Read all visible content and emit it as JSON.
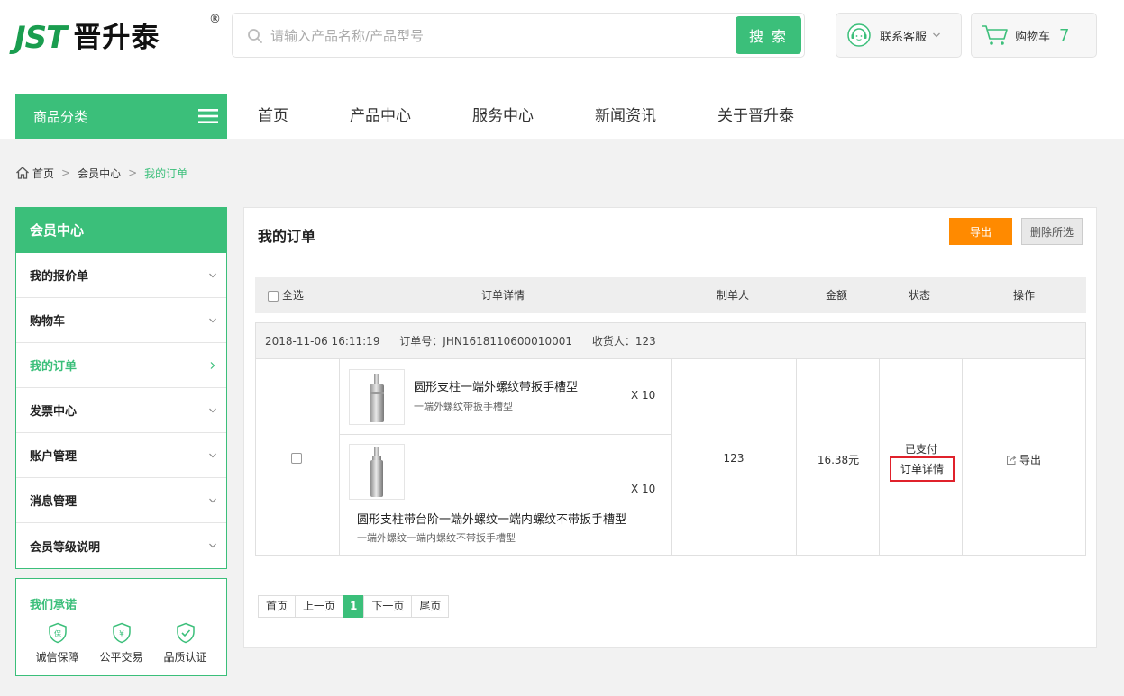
{
  "header": {
    "logo_en": "JST",
    "logo_cn": "晋升泰",
    "logo_reg": "®",
    "search_placeholder": "请输入产品名称/产品型号",
    "search_button": "搜 索",
    "service_label": "联系客服",
    "cart_label": "购物车",
    "cart_count": "7"
  },
  "nav": {
    "category_label": "商品分类",
    "items": [
      "首页",
      "产品中心",
      "服务中心",
      "新闻资讯",
      "关于晋升泰"
    ]
  },
  "breadcrumb": {
    "home": "首页",
    "member": "会员中心",
    "current": "我的订单",
    "sep": ">"
  },
  "sidebar": {
    "title": "会员中心",
    "items": [
      "我的报价单",
      "购物车",
      "我的订单",
      "发票中心",
      "账户管理",
      "消息管理",
      "会员等级说明"
    ],
    "active_index": 2
  },
  "promise": {
    "title": "我们承诺",
    "items": [
      "诚信保障",
      "公平交易",
      "品质认证"
    ],
    "icon_glyphs": [
      "保",
      "¥",
      "✓"
    ]
  },
  "main": {
    "title": "我的订单",
    "export_button": "导出",
    "delete_button": "删除所选",
    "columns": {
      "select_all": "全选",
      "detail": "订单详情",
      "creator": "制单人",
      "amount": "金额",
      "status": "状态",
      "action": "操作"
    }
  },
  "order": {
    "date": "2018-11-06  16:11:19",
    "order_no": "订单号：JHN1618110600010001",
    "receiver": "收货人：123",
    "products": [
      {
        "name": "圆形支柱一端外螺纹带扳手槽型",
        "sub": "一端外螺纹带扳手槽型",
        "qty": "X 10"
      },
      {
        "name": "圆形支柱带台阶一端外螺纹一端内螺纹不带扳手槽型",
        "sub": "一端外螺纹一端内螺纹不带扳手槽型",
        "qty": "X 10"
      }
    ],
    "creator": "123",
    "amount": "16.38元",
    "status": "已支付",
    "detail_link": "订单详情",
    "export_link": "导出"
  },
  "pager": {
    "first": "首页",
    "prev": "上一页",
    "current": "1",
    "next": "下一页",
    "last": "尾页"
  },
  "colors": {
    "brand_green": "#3bbf7a",
    "export_orange": "#ff8a00",
    "highlight_red": "#e0212b"
  }
}
